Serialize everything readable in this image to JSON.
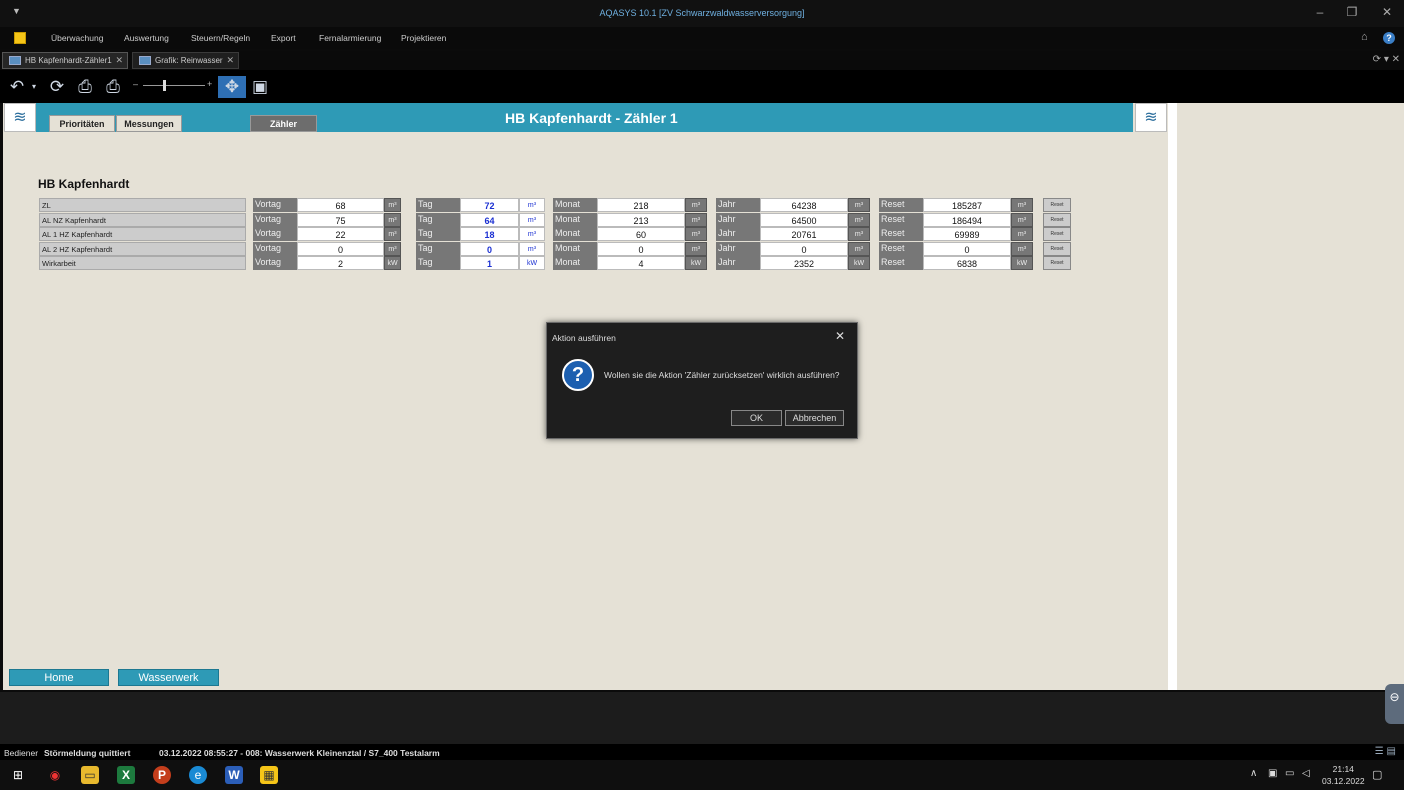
{
  "window": {
    "title": "AQASYS 10.1 [ZV Schwarzwaldwasserversorgung]"
  },
  "menu": {
    "items": [
      "Überwachung",
      "Auswertung",
      "Steuern/Regeln",
      "Export",
      "Fernalarmierung",
      "Projektieren"
    ]
  },
  "tabs": [
    {
      "label": "HB Kapfenhardt-Zähler1",
      "active": true
    },
    {
      "label": "Grafik: Reinwasser",
      "active": false
    }
  ],
  "hmi": {
    "nav_tabs": [
      "Prioritäten",
      "Messungen",
      "Zähler"
    ],
    "selected_tab": "Zähler",
    "title": "HB Kapfenhardt - Zähler 1",
    "station": "HB Kapfenhardt",
    "group_labels": {
      "vortag": "Vortag",
      "tag": "Tag",
      "monat": "Monat",
      "jahr": "Jahr",
      "reset": "Reset"
    },
    "reset_button_label": "Reset",
    "rows": [
      {
        "label": "ZL",
        "vortag": "68",
        "tag": "72",
        "monat": "218",
        "jahr": "64238",
        "reset": "185287",
        "unit": "m³"
      },
      {
        "label": "AL NZ Kapfenhardt",
        "vortag": "75",
        "tag": "64",
        "monat": "213",
        "jahr": "64500",
        "reset": "186494",
        "unit": "m³"
      },
      {
        "label": "AL 1 HZ Kapfenhardt",
        "vortag": "22",
        "tag": "18",
        "monat": "60",
        "jahr": "20761",
        "reset": "69989",
        "unit": "m³"
      },
      {
        "label": "AL 2 HZ Kapfenhardt",
        "vortag": "0",
        "tag": "0",
        "monat": "0",
        "jahr": "0",
        "reset": "0",
        "unit": "m³"
      },
      {
        "label": "Wirkarbeit",
        "vortag": "2",
        "tag": "1",
        "monat": "4",
        "jahr": "2352",
        "reset": "6838",
        "unit": "kW"
      }
    ],
    "nav_buttons": {
      "home": "Home",
      "wasserwerk": "Wasserwerk"
    }
  },
  "dialog": {
    "title": "Aktion ausführen",
    "message": "Wollen sie die Aktion 'Zähler zurücksetzen' wirklich ausführen?",
    "ok": "OK",
    "cancel": "Abbrechen"
  },
  "statusbar": {
    "user_label": "Bediener",
    "message": "Störmeldung quittiert",
    "event": "03.12.2022 08:55:27 - 008:  Wasserwerk Kleinenztal / S7_400 Testalarm"
  },
  "taskbar": {
    "time": "21:14",
    "date": "03.12.2022"
  },
  "icons": {
    "toolbar": [
      "undo-icon",
      "refresh-icon",
      "print-icon",
      "print-preview-icon",
      "zoom-slider",
      "move-icon",
      "slideshow-icon"
    ],
    "taskbar": [
      "start-icon",
      "aqasys-icon",
      "explorer-icon",
      "excel-icon",
      "powerpoint-icon",
      "edge-icon",
      "word-icon"
    ]
  },
  "colors": {
    "accent": "#2e9ab6",
    "dialog_bg": "#1e1e1e",
    "highlight_blue": "#1a2fd2",
    "titlebar_text": "#6fb0e0"
  }
}
